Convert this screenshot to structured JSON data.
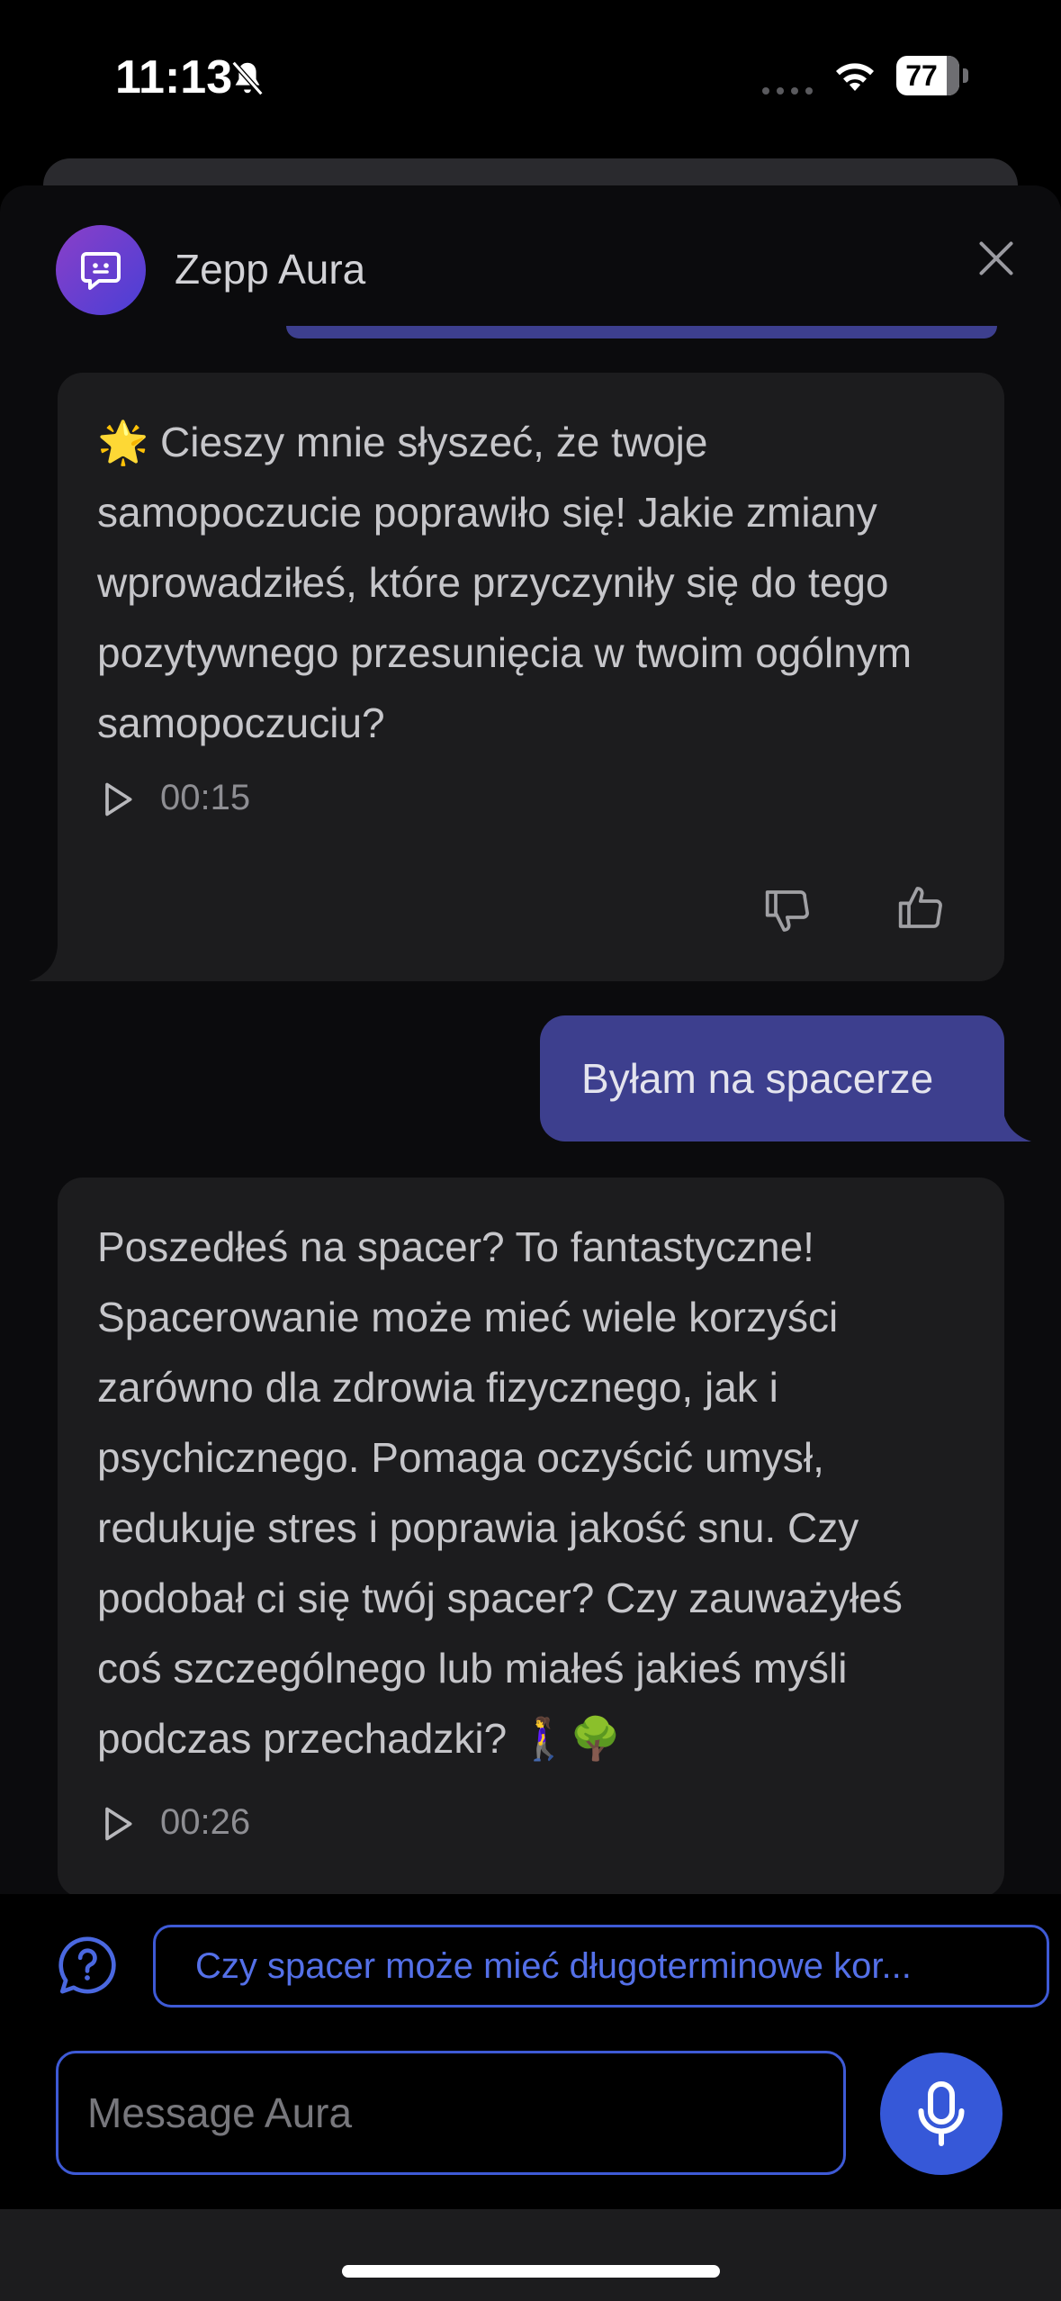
{
  "status_bar": {
    "time": "11:13",
    "battery": "77",
    "icons": [
      "bell-slash-icon",
      "signal-dots-icon",
      "wifi-icon",
      "battery-icon"
    ]
  },
  "header": {
    "title": "Zepp Aura",
    "avatar_icon": "chat-bot-icon",
    "close_icon": "close-icon"
  },
  "messages": [
    {
      "role": "assistant",
      "text": "🌟 Cieszy mnie słyszeć, że twoje samopoczucie poprawiło się! Jakie zmiany wprowadziłeś, które przyczyniły się do tego pozytywnego przesunięcia w twoim ogólnym samopoczuciu?",
      "audio_duration": "00:15"
    },
    {
      "role": "user",
      "text": "Byłam na spacerze"
    },
    {
      "role": "assistant",
      "text": "Poszedłeś na spacer? To fantastyczne! Spacerowanie może mieć wiele korzyści zarówno dla zdrowia fizycznego, jak i psychicznego. Pomaga oczyścić umysł, redukuje stres i poprawia jakość snu. Czy podobał ci się twój spacer? Czy zauważyłeś coś szczególnego lub miałeś jakieś myśli podczas przechadzki? 🚶‍♀️🌳",
      "audio_duration": "00:26"
    }
  ],
  "suggestion": {
    "text": "Czy spacer może mieć długoterminowe kor..."
  },
  "composer": {
    "placeholder": "Message Aura"
  },
  "colors": {
    "accent": "#3658d8",
    "user_bubble": "#3d3f8e",
    "ai_bubble": "#1c1c1e",
    "background": "#0b0b0d"
  }
}
